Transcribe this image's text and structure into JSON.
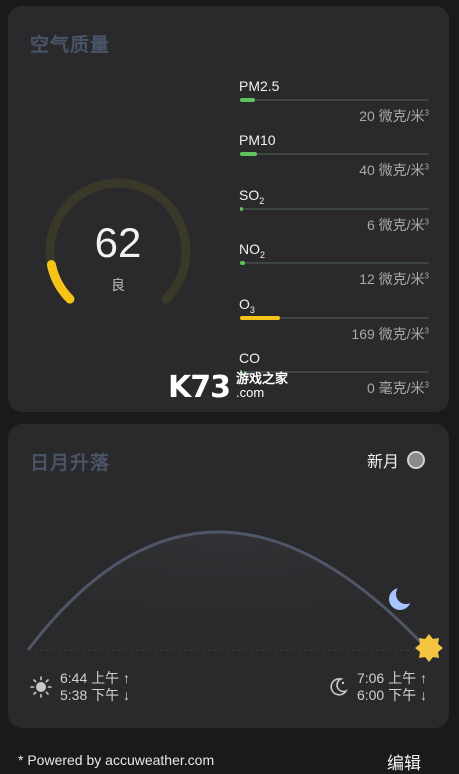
{
  "air_quality": {
    "title": "空气质量",
    "aqi": "62",
    "grade": "良",
    "aqi_fraction": 0.124,
    "colors": {
      "track": "#3a3828",
      "fill": "#f4c518"
    },
    "pollutants": [
      {
        "name": "PM2.5",
        "value": "20 微克/米",
        "unit_sup": "3",
        "fraction": 0.08,
        "color": "#5fc35f"
      },
      {
        "name": "PM10",
        "value": "40 微克/米",
        "unit_sup": "3",
        "fraction": 0.09,
        "color": "#5fc35f"
      },
      {
        "name": "SO",
        "sub": "2",
        "value": "6 微克/米",
        "unit_sup": "3",
        "fraction": 0.015,
        "color": "#5fc35f"
      },
      {
        "name": "NO",
        "sub": "2",
        "value": "12 微克/米",
        "unit_sup": "3",
        "fraction": 0.025,
        "color": "#5fc35f"
      },
      {
        "name": "O",
        "sub": "3",
        "value": "169 微克/米",
        "unit_sup": "3",
        "fraction": 0.21,
        "color": "#f4c518"
      },
      {
        "name": "CO",
        "value": "0 毫克/米",
        "unit_sup": "3",
        "fraction": 0.0,
        "color": "#5fc35f"
      }
    ]
  },
  "watermark": {
    "brand": "K73",
    "cn": "游戏之家",
    "domain": ".com"
  },
  "sun_moon": {
    "title": "日月升落",
    "moon_phase": "新月",
    "sunrise": "6:44 上午 ↑",
    "sunset": "5:38 下午 ↓",
    "moonrise": "7:06 上午 ↑",
    "moonset": "6:00 下午 ↓",
    "colors": {
      "arc": "#4f5668",
      "sun": "#f4c542",
      "moon": "#a8c4ff"
    }
  },
  "footer": {
    "powered_by": "* Powered by accuweather.com",
    "edit": "编辑"
  }
}
